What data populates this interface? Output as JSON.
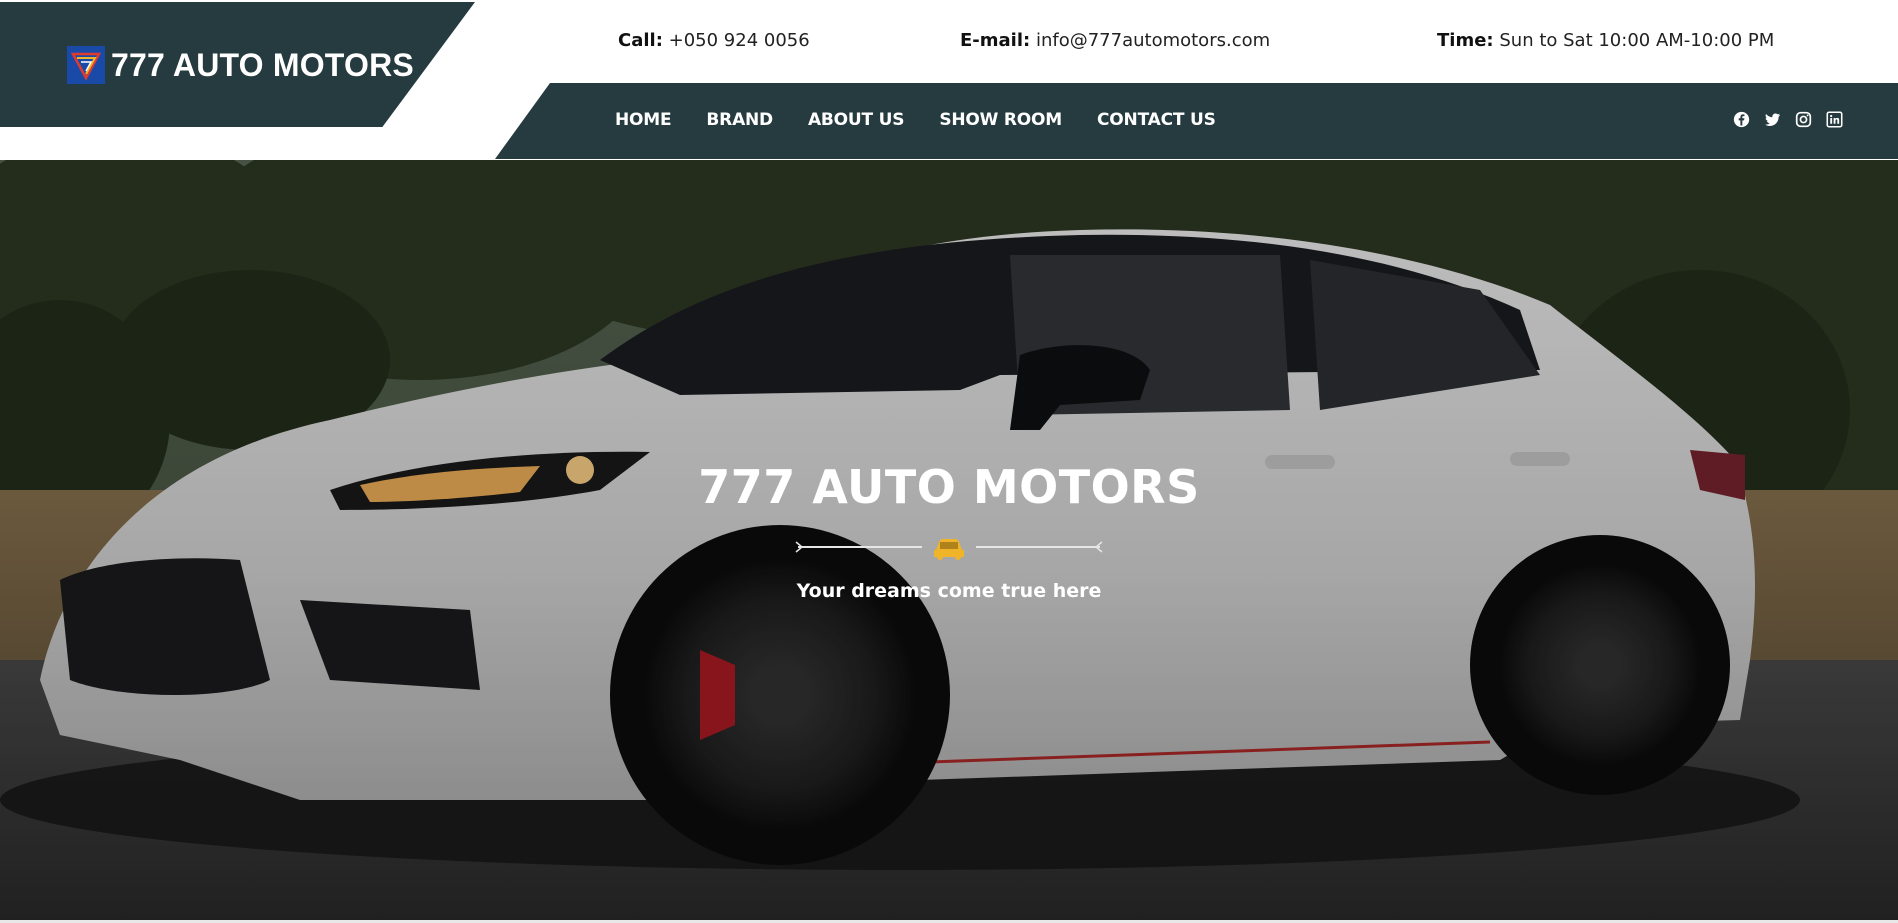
{
  "brand": {
    "name": "777 AUTO MOTORS",
    "logo_icon": "triple-seven-logo-icon",
    "colors": {
      "header_dark": "#263b40",
      "accent": "#f0b429",
      "logo_blue": "#1a4aa8",
      "logo_red": "#e03a2f"
    }
  },
  "contact": {
    "call_label": "Call:",
    "call_value": "+050 924 0056",
    "email_label": "E-mail:",
    "email_value": "info@777automotors.com",
    "time_label": "Time:",
    "time_value": "Sun to Sat 10:00 AM-10:00 PM"
  },
  "nav": {
    "items": [
      {
        "label": "HOME"
      },
      {
        "label": "BRAND"
      },
      {
        "label": "ABOUT US"
      },
      {
        "label": "SHOW ROOM"
      },
      {
        "label": "CONTACT US"
      }
    ],
    "social": [
      "facebook-icon",
      "twitter-icon",
      "instagram-icon",
      "linkedin-icon"
    ]
  },
  "hero": {
    "title": "777 AUTO MOTORS",
    "divider_icon": "car-icon",
    "subtitle": "Your dreams come true here"
  }
}
